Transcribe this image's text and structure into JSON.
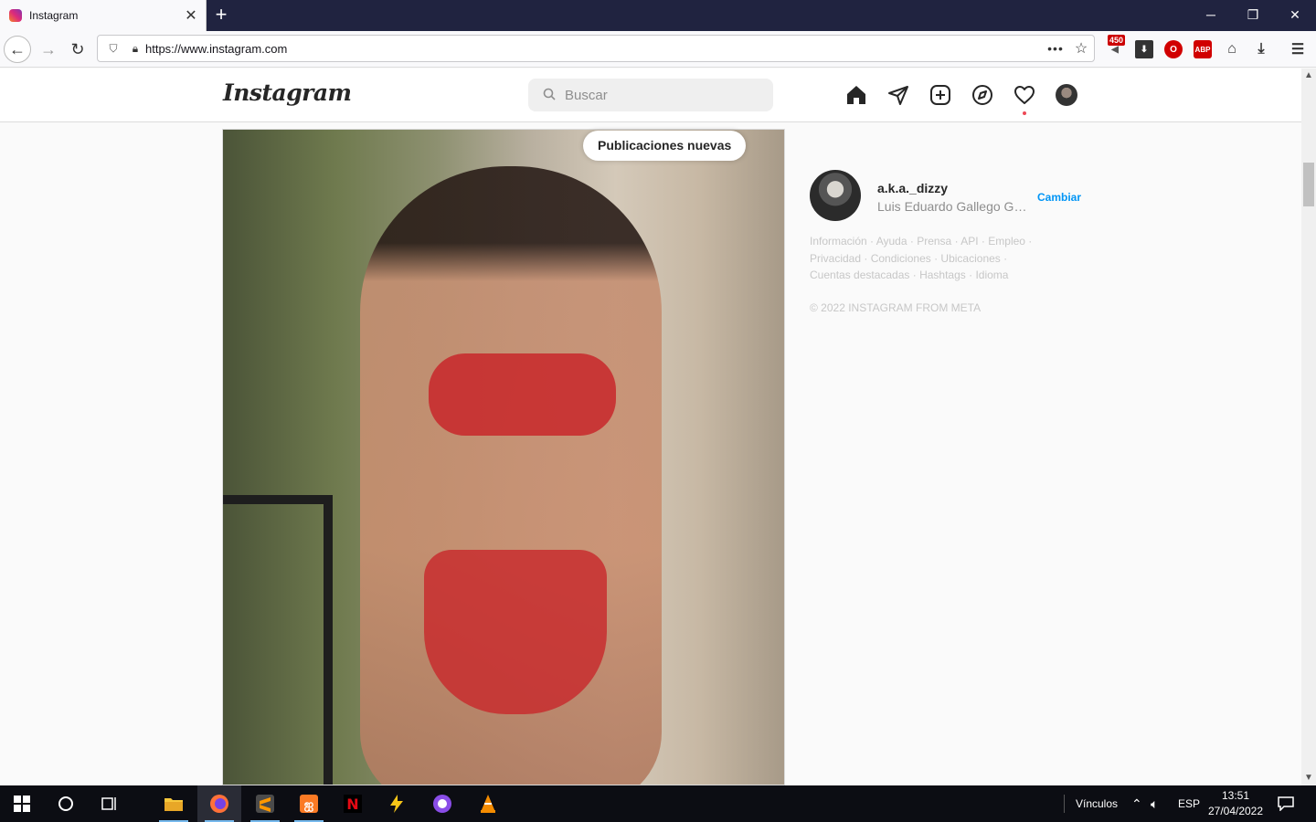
{
  "browser": {
    "tab_title": "Instagram",
    "url": "https://www.instagram.com",
    "extension_badge": "450"
  },
  "instagram": {
    "logo": "Instagram",
    "search_placeholder": "Buscar",
    "new_posts_label": "Publicaciones nuevas",
    "profile": {
      "username": "a.k.a._dizzy",
      "full_name": "Luis Eduardo Gallego Gar...",
      "switch_label": "Cambiar"
    },
    "footer_links": [
      "Información",
      "Ayuda",
      "Prensa",
      "API",
      "Empleo",
      "Privacidad",
      "Condiciones",
      "Ubicaciones",
      "Cuentas destacadas",
      "Hashtags",
      "Idioma"
    ],
    "copyright": "© 2022 INSTAGRAM FROM META"
  },
  "taskbar": {
    "links_label": "Vínculos",
    "language": "ESP",
    "time": "13:51",
    "date": "27/04/2022"
  },
  "colors": {
    "accent_blue": "#0095f6",
    "notification_red": "#ed4956",
    "titlebar": "#202340"
  }
}
